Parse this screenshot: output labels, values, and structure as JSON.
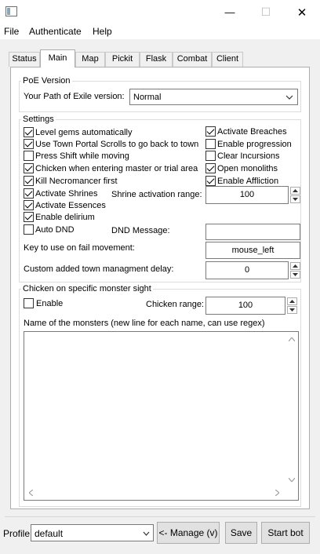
{
  "window": {
    "title": "",
    "minimize_glyph": "—",
    "maximize_glyph": "☐",
    "close_glyph": "✕"
  },
  "menu": [
    "File",
    "Authenticate",
    "Help"
  ],
  "tabs": [
    {
      "label": "Status",
      "active": false
    },
    {
      "label": "Main",
      "active": true
    },
    {
      "label": "Map",
      "active": false
    },
    {
      "label": "Pickit",
      "active": false
    },
    {
      "label": "Flask",
      "active": false
    },
    {
      "label": "Combat",
      "active": false
    },
    {
      "label": "Client",
      "active": false
    }
  ],
  "poe_version": {
    "group_title": "PoE Version",
    "label": "Your Path of Exile version:",
    "value": "Normal"
  },
  "settings": {
    "group_title": "Settings",
    "left_checks": [
      {
        "label": "Level gems automatically",
        "checked": true
      },
      {
        "label": "Use Town Portal Scrolls to go back to town",
        "checked": true
      },
      {
        "label": "Press Shift while moving",
        "checked": false
      },
      {
        "label": "Chicken when entering master or trial area",
        "checked": true
      },
      {
        "label": "Kill Necromancer first",
        "checked": true
      },
      {
        "label": "Activate Shrines",
        "checked": true
      },
      {
        "label": "Activate Essences",
        "checked": true
      },
      {
        "label": "Enable delirium",
        "checked": true
      },
      {
        "label": "Auto DND",
        "checked": false
      }
    ],
    "right_checks": [
      {
        "label": "Activate Breaches",
        "checked": true
      },
      {
        "label": "Enable progression",
        "checked": false
      },
      {
        "label": "Clear Incursions",
        "checked": false
      },
      {
        "label": "Open monoliths",
        "checked": true
      },
      {
        "label": "Enable Affliction",
        "checked": true
      }
    ],
    "shrine_range_label": "Shrine activation range:",
    "shrine_range_value": "100",
    "dnd_label": "DND Message:",
    "dnd_value": "",
    "fail_key_label": "Key to use on fail movement:",
    "fail_key_value": "mouse_left",
    "town_delay_label": "Custom added town managment delay:",
    "town_delay_value": "0"
  },
  "chicken": {
    "group_title": "Chicken on specific monster sight",
    "enable_label": "Enable",
    "enable_checked": false,
    "range_label": "Chicken range:",
    "range_value": "100",
    "monsters_label": "Name of the monsters (new line for each name, can use regex)",
    "monsters_text": ""
  },
  "footer": {
    "profile_label": "Profile:",
    "profile_value": "default",
    "manage_label": "<- Manage (v)",
    "save_label": "Save",
    "start_label": "Start bot"
  }
}
